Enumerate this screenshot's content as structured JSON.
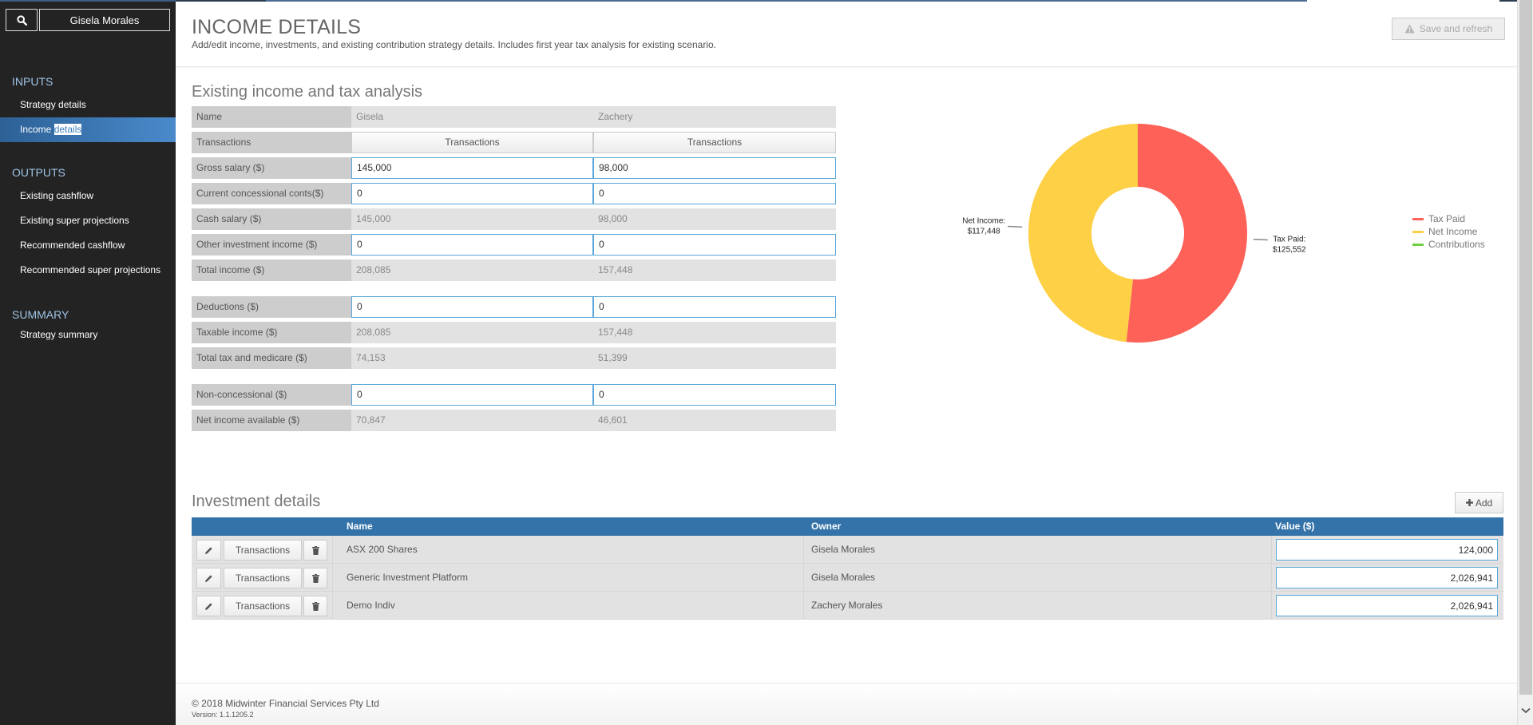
{
  "sidebar": {
    "search_icon": "search-icon",
    "client_name": "Gisela Morales",
    "sections": [
      {
        "heading": "INPUTS",
        "items": [
          {
            "label": "Strategy details"
          },
          {
            "label_prefix": "Income ",
            "label_selected": "details",
            "active": true
          }
        ]
      },
      {
        "heading": "OUTPUTS",
        "items": [
          {
            "label": "Existing cashflow"
          },
          {
            "label": "Existing super projections"
          },
          {
            "label": "Recommended cashflow"
          },
          {
            "label": "Recommended super projections"
          }
        ]
      },
      {
        "heading": "SUMMARY",
        "items": [
          {
            "label": "Strategy summary"
          }
        ]
      }
    ]
  },
  "header": {
    "title": "INCOME DETAILS",
    "subtitle": "Add/edit income, investments, and existing contribution strategy details. Includes first year tax analysis for existing scenario.",
    "save_button": "Save and refresh",
    "save_icon": "warning-icon"
  },
  "income": {
    "section_title": "Existing income and tax analysis",
    "rows": [
      {
        "label": "Name",
        "type": "text",
        "values": [
          "Gisela",
          "Zachery"
        ]
      },
      {
        "label": "Transactions",
        "type": "button",
        "values": [
          "Transactions",
          "Transactions"
        ]
      },
      {
        "label": "Gross salary ($)",
        "type": "input",
        "values": [
          "145,000",
          "98,000"
        ]
      },
      {
        "label": "Current concessional conts($)",
        "type": "input",
        "values": [
          "0",
          "0"
        ]
      },
      {
        "label": "Cash salary ($)",
        "type": "text",
        "values": [
          "145,000",
          "98,000"
        ]
      },
      {
        "label": "Other investment income ($)",
        "type": "input",
        "values": [
          "0",
          "0"
        ]
      },
      {
        "label": "Total income ($)",
        "type": "text",
        "values": [
          "208,085",
          "157,448"
        ]
      },
      {
        "label": "Deductions ($)",
        "type": "input",
        "values": [
          "0",
          "0"
        ]
      },
      {
        "label": "Taxable income ($)",
        "type": "text",
        "values": [
          "208,085",
          "157,448"
        ]
      },
      {
        "label": "Total tax and medicare ($)",
        "type": "text",
        "values": [
          "74,153",
          "51,399"
        ]
      },
      {
        "label": "Non-concessional ($)",
        "type": "input",
        "values": [
          "0",
          "0"
        ]
      },
      {
        "label": "Net income available ($)",
        "type": "text",
        "values": [
          "70,847",
          "46,601"
        ]
      }
    ]
  },
  "chart_data": {
    "type": "pie",
    "donut": true,
    "title": "",
    "slices": [
      {
        "name": "Tax Paid",
        "value": 125552,
        "label": "Tax Paid:",
        "value_label": "$125,552",
        "color": "#fe6157"
      },
      {
        "name": "Net Income",
        "value": 117448,
        "label": "Net Income:",
        "value_label": "$117,448",
        "color": "#fed046"
      },
      {
        "name": "Contributions",
        "value": 0,
        "label": "",
        "value_label": "",
        "color": "#6ccf44"
      }
    ],
    "legend": {
      "placement": "right",
      "entries": [
        "Tax Paid",
        "Net Income",
        "Contributions"
      ]
    }
  },
  "investments": {
    "section_title": "Investment details",
    "add_button": "Add",
    "columns": [
      "",
      "Name",
      "Owner",
      "Value ($)"
    ],
    "row_button": "Transactions",
    "rows": [
      {
        "name": "ASX 200 Shares",
        "owner": "Gisela Morales",
        "value": "124,000"
      },
      {
        "name": "Generic Investment Platform",
        "owner": "Gisela Morales",
        "value": "2,026,941"
      },
      {
        "name": "Demo Indiv",
        "owner": "Zachery Morales",
        "value": "2,026,941"
      }
    ]
  },
  "footer": {
    "copyright": "© 2018 Midwinter Financial Services Pty Ltd",
    "version": "Version: 1.1.1205.2"
  },
  "colors": {
    "sidebar_bg": "#232323",
    "accent": "#3473a9",
    "input_border": "#5aa7d9"
  }
}
